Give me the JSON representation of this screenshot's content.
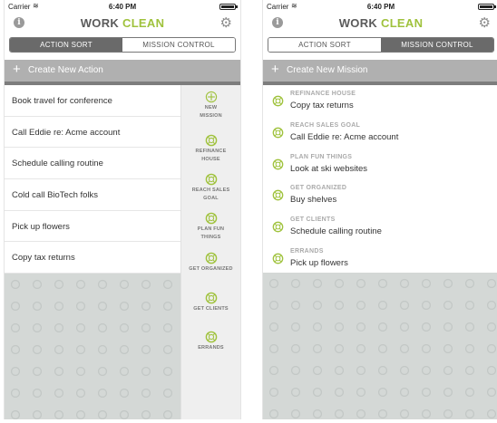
{
  "status": {
    "carrier": "Carrier",
    "time": "6:40 PM"
  },
  "header": {
    "title_part1": "WORK",
    "title_part2": "CLEAN"
  },
  "tabs": {
    "action_sort": "ACTION SORT",
    "mission_control": "MISSION CONTROL"
  },
  "left": {
    "create_label": "Create New Action",
    "actions": [
      "Book travel for conference",
      "Call Eddie re: Acme account",
      "Schedule calling routine",
      "Cold call BioTech folks",
      "Pick up flowers",
      "Copy tax returns"
    ],
    "missions": [
      {
        "label1": "NEW",
        "label2": "MISSION"
      },
      {
        "label1": "REFINANCE",
        "label2": "HOUSE"
      },
      {
        "label1": "REACH SALES",
        "label2": "GOAL"
      },
      {
        "label1": "PLAN FUN",
        "label2": "THINGS"
      },
      {
        "label1": "GET ORGANIZED",
        "label2": ""
      },
      {
        "label1": "GET CLIENTS",
        "label2": ""
      },
      {
        "label1": "ERRANDS",
        "label2": ""
      }
    ]
  },
  "right": {
    "create_label": "Create New Mission",
    "missions": [
      {
        "category": "REFINANCE HOUSE",
        "task": "Copy tax returns"
      },
      {
        "category": "REACH SALES GOAL",
        "task": "Call Eddie re: Acme account"
      },
      {
        "category": "PLAN FUN THINGS",
        "task": "Look at ski websites"
      },
      {
        "category": "GET ORGANIZED",
        "task": "Buy shelves"
      },
      {
        "category": "GET CLIENTS",
        "task": "Schedule calling routine"
      },
      {
        "category": "ERRANDS",
        "task": "Pick up flowers"
      }
    ]
  },
  "colors": {
    "accent": "#9fc23c",
    "dark": "#6a6a6a",
    "bar": "#b0b0b0"
  }
}
